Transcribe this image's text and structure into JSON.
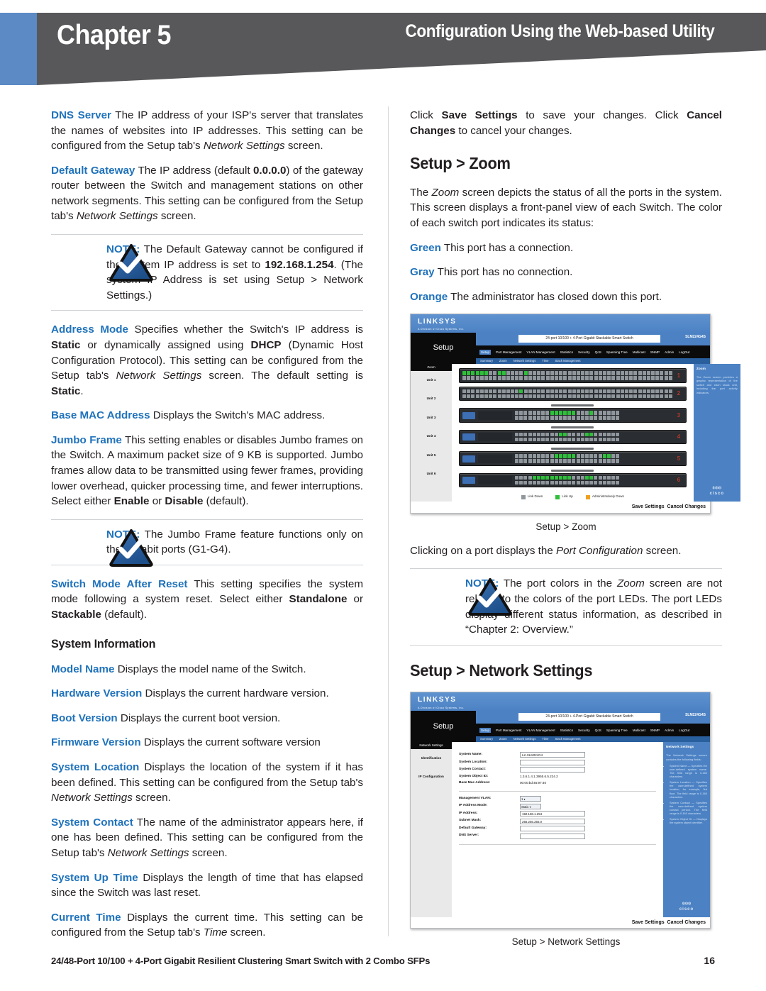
{
  "header": {
    "chapter_word": "Chapter",
    "chapter_number": "5",
    "right_title": "Configuration Using the Web-based Utility"
  },
  "left_column": {
    "p_dns_term": "DNS Server",
    "p_dns_text": " The IP address of your ISP's server that translates the names of websites into IP addresses. This setting can be configured from the Setup tab's ",
    "p_dns_italic": "Network Settings",
    "p_dns_tail": " screen.",
    "p_gw_term": "Default Gateway",
    "p_gw_text_a": "  The IP address (default ",
    "p_gw_bold": "0.0.0.0",
    "p_gw_text_b": ") of the gateway router between the Switch and management stations on other network segments. This setting can be configured from the Setup tab's ",
    "p_gw_italic": "Network Settings",
    "p_gw_tail": " screen.",
    "note1_label": "NOTE:",
    "note1_text_a": " The Default Gateway cannot be configured if the system IP address is set to ",
    "note1_bold": "192.168.1.254",
    "note1_text_b": ". (The system IP Address is set using Setup > Network Settings.)",
    "p_am_term": "Address Mode",
    "p_am_a": "  Specifies whether the Switch's IP address is ",
    "p_am_b1": "Static",
    "p_am_b": " or dynamically assigned using ",
    "p_am_b2": "DHCP",
    "p_am_c": " (Dynamic Host Configuration Protocol). This setting can be configured from the Setup tab's ",
    "p_am_italic": "Network Settings",
    "p_am_d": " screen. The default setting is ",
    "p_am_b3": "Static",
    "p_am_e": ".",
    "p_mac_term": "Base MAC Address",
    "p_mac_text": "  Displays the Switch's MAC address.",
    "p_jumbo_term": "Jumbo Frame",
    "p_jumbo_a": " This setting enables or disables Jumbo frames on the Switch. A maximum packet size of 9 KB is supported. Jumbo frames allow data to be transmitted using fewer frames, providing lower overhead, quicker processing time, and fewer interruptions. Select either ",
    "p_jumbo_b1": "Enable",
    "p_jumbo_b": " or ",
    "p_jumbo_b2": "Disable",
    "p_jumbo_c": " (default).",
    "note2_label": "NOTE:",
    "note2_text": " The Jumbo Frame feature functions only on the Gigabit ports (G1-G4).",
    "p_smar_term": "Switch Mode After Reset",
    "p_smar_a": " This setting specifies the system mode following a system reset. Select either ",
    "p_smar_b1": "Standalone",
    "p_smar_b": " or ",
    "p_smar_b2": "Stackable",
    "p_smar_c": " (default).",
    "sys_info_heading": "System Information",
    "p_model_term": "Model Name",
    "p_model_text": "  Displays the model name of the Switch.",
    "p_hw_term": "Hardware Version",
    "p_hw_text": "  Displays the current hardware version.",
    "p_boot_term": "Boot Version",
    "p_boot_text": "  Displays the current boot version.",
    "p_fw_term": "Firmware Version",
    "p_fw_text": "  Displays the current software version",
    "p_loc_term": "System Location",
    "p_loc_a": "  Displays the location of the system if it has been defined. This setting can be configured from the Setup tab's ",
    "p_loc_italic": "Network Settings",
    "p_loc_b": " screen.",
    "p_contact_term": "System Contact",
    "p_contact_a": "  The name of the administrator appears here, if one has been defined. This setting can be configured from the Setup tab's ",
    "p_contact_italic": "Network Settings",
    "p_contact_b": " screen.",
    "p_uptime_term": "System Up Time",
    "p_uptime_text": " Displays the length of time that has elapsed since the Switch was last reset.",
    "p_curtime_term": "Current Time",
    "p_curtime_a": "  Displays the current time. This setting can be configured from the Setup tab's ",
    "p_curtime_italic": "Time",
    "p_curtime_b": " screen."
  },
  "right_column": {
    "p_save_a": "Click ",
    "p_save_b1": "Save Settings",
    "p_save_b": " to save your changes. Click ",
    "p_save_b2": "Cancel Changes",
    "p_save_c": " to cancel your changes.",
    "heading_zoom": "Setup > Zoom",
    "p_zoom_a": "The ",
    "p_zoom_italic": "Zoom",
    "p_zoom_b": " screen depicts the status of all the ports in the system. This screen displays a front-panel view of each Switch. The color of each switch port indicates its status:",
    "status_green_term": "Green",
    "status_green_text": "  This port has a connection.",
    "status_gray_term": "Gray",
    "status_gray_text": "  This port has no connection.",
    "status_orange_term": "Orange",
    "status_orange_text": "  The administrator has closed down this port.",
    "fig1_caption": "Setup > Zoom",
    "p_click_a": "Clicking on a port displays the ",
    "p_click_italic": "Port Configuration",
    "p_click_b": " screen.",
    "note3_label": "NOTE:",
    "note3_a": " The port colors in the ",
    "note3_italic": "Zoom",
    "note3_b": " screen are not related to the colors of the port LEDs. The port LEDs display different status information, as described in “Chapter 2: Overview.”",
    "heading_netset": "Setup > Network Settings",
    "fig2_caption": "Setup > Network Settings"
  },
  "screenshot_zoom": {
    "brand": "LINKSYS",
    "brand_sub": "A Division of Cisco Systems, Inc.",
    "setup_tab": "Setup",
    "model_banner": "24-port 10/100 + 4-Port Gigabit Stackable Smart Switch",
    "sku": "SLM224G4S",
    "menu": [
      "Setup",
      "Port Management",
      "VLAN Management",
      "Statistics",
      "Security",
      "QoS",
      "Spanning Tree",
      "Multicast",
      "SNMP",
      "Admin",
      "LogOut"
    ],
    "submenu": [
      "Summary",
      "Zoom",
      "Network Settings",
      "Time",
      "Stack Management"
    ],
    "sidebar_header": "Zoom",
    "sidebar_items": [
      "Unit 1",
      "Unit 2",
      "Unit 3",
      "Unit 4",
      "Unit 5",
      "Unit 6"
    ],
    "help_title": "Zoom",
    "help_text": "The Zoom screen provides a graphic representation of the switch and each stack unit, including the port activity indicators.",
    "legend": [
      {
        "label": "Link Down",
        "color": "#8f969c"
      },
      {
        "label": "Link Up",
        "color": "#2fbf3b"
      },
      {
        "label": "Administratively Down",
        "color": "#f0a020"
      }
    ],
    "save_label": "Save Settings",
    "cancel_label": "Cancel Changes",
    "cisco_label": "cisco"
  },
  "screenshot_netset": {
    "brand": "LINKSYS",
    "brand_sub": "A Division of Cisco Systems, Inc.",
    "setup_tab": "Setup",
    "model_banner": "24-port 10/100 + 4-Port Gigabit Stackable Smart Switch",
    "sku": "SLM224G4S",
    "menu": [
      "Setup",
      "Port Management",
      "VLAN Management",
      "Statistics",
      "Security",
      "QoS",
      "Spanning Tree",
      "Multicast",
      "SNMP",
      "Admin",
      "LogOut"
    ],
    "submenu": [
      "Summary",
      "Zoom",
      "Network Settings",
      "Time",
      "Stack Management"
    ],
    "sidebar_header": "Network Settings",
    "sidebar_items": [
      "Identification",
      "IP Configuration"
    ],
    "identification": [
      {
        "label": "System Name",
        "value": "LK-SLM224G4",
        "type": "input"
      },
      {
        "label": "System Location",
        "value": "",
        "type": "input"
      },
      {
        "label": "System Contact",
        "value": "",
        "type": "input"
      },
      {
        "label": "System Object ID",
        "value": "1.3.6.1.4.1.3955.6.5.224.2",
        "type": "text"
      },
      {
        "label": "Base Mac Address",
        "value": "00:00:bd:45:97:40",
        "type": "text"
      }
    ],
    "ip_configuration": [
      {
        "label": "Management VLAN",
        "value": "1",
        "type": "select"
      },
      {
        "label": "IP Address Mode",
        "value": "Static",
        "type": "select"
      },
      {
        "label": "IP Address",
        "value": "192.168.1.254",
        "type": "input"
      },
      {
        "label": "Subnet Mask",
        "value": "255.255.255.0",
        "type": "input"
      },
      {
        "label": "Default Gateway",
        "value": "",
        "type": "input"
      },
      {
        "label": "DNS Server",
        "value": "",
        "type": "input"
      }
    ],
    "help_title": "Network Settings",
    "help_text": "The Network Settings screen contains the following fields:",
    "help_items": [
      "System Name — Specifies the user-defined system name. The field range is 0-160 characters.",
      "System Location — Specifies the user-defined system location, for example, 3rd floor. The field range is 0-160 characters.",
      "System Contact — Specifies the user-defined system contact person. The field range is 0-160 characters.",
      "System Object ID — Displays the system object identifier."
    ],
    "save_label": "Save Settings",
    "cancel_label": "Cancel Changes",
    "cisco_label": "cisco"
  },
  "footer": {
    "text": "24/48-Port 10/100 + 4-Port Gigabit Resilient Clustering Smart Switch with 2 Combo SFPs",
    "page_number": "16"
  },
  "colors": {
    "accent_blue": "#1f72bb",
    "header_gray": "#58585a",
    "header_blue": "#5b8ac5",
    "port_green": "#2fbf3b",
    "port_gray": "#8f969c",
    "port_orange": "#f0a020"
  }
}
